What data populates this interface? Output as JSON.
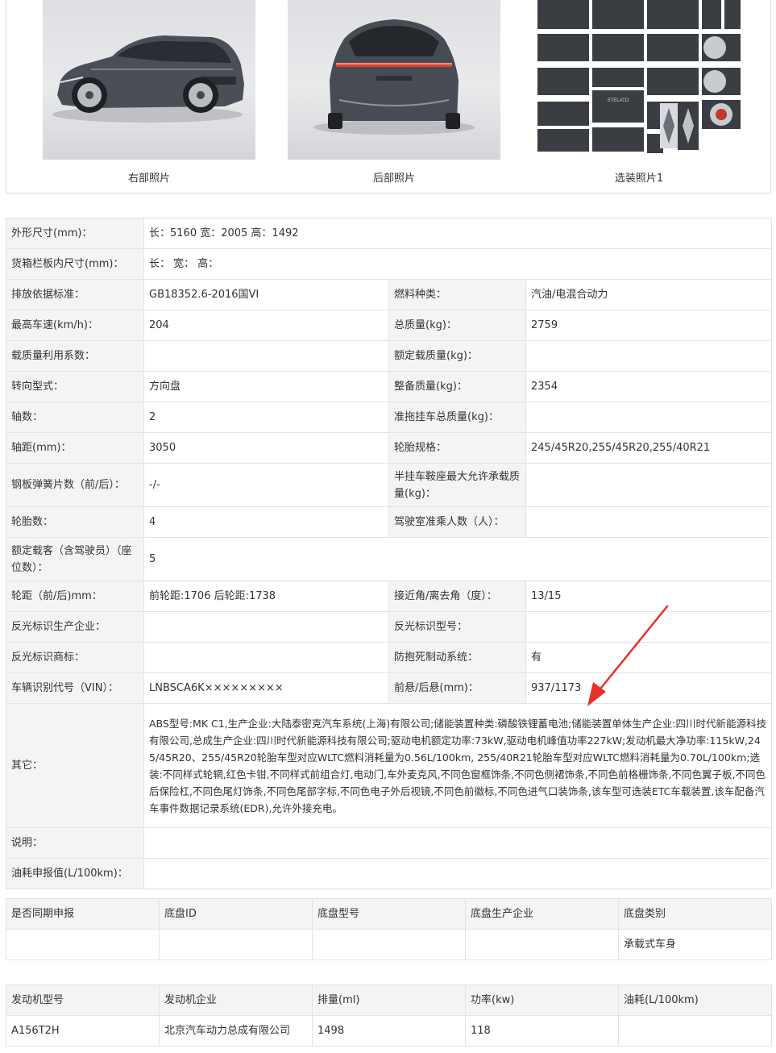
{
  "photos": [
    {
      "caption": "右部照片",
      "icon": "car-right-side-photo"
    },
    {
      "caption": "后部照片",
      "icon": "car-rear-photo",
      "plate_text": "STELATO"
    },
    {
      "caption": "选装照片1",
      "icon": "option-photo-collage"
    }
  ],
  "spec": {
    "dims": {
      "label": "外形尺寸(mm)：",
      "value": "长：5160 宽：2005 高：1492"
    },
    "cargo": {
      "label": "货箱栏板内尺寸(mm)：",
      "value": "长： 宽： 高："
    },
    "rows": [
      {
        "l1": "排放依据标准：",
        "v1": "GB18352.6-2016国VI",
        "l2": "燃料种类：",
        "v2": "汽油/电混合动力"
      },
      {
        "l1": "最高车速(km/h)：",
        "v1": "204",
        "l2": "总质量(kg)：",
        "v2": "2759"
      },
      {
        "l1": "载质量利用系数：",
        "v1": "",
        "l2": "额定载质量(kg)：",
        "v2": ""
      },
      {
        "l1": "转向型式：",
        "v1": "方向盘",
        "l2": "整备质量(kg)：",
        "v2": "2354"
      },
      {
        "l1": "轴数：",
        "v1": "2",
        "l2": "准拖挂车总质量(kg)：",
        "v2": ""
      },
      {
        "l1": "轴距(mm)：",
        "v1": "3050",
        "l2": "轮胎规格：",
        "v2": "245/45R20,255/45R20,255/40R21"
      },
      {
        "l1": "钢板弹簧片数（前/后）：",
        "v1": "-/-",
        "l2": "半挂车鞍座最大允许承载质量(kg)：",
        "v2": ""
      },
      {
        "l1": "轮胎数：",
        "v1": "4",
        "l2": "驾驶室准乘人数（人）：",
        "v2": ""
      }
    ],
    "seats": {
      "label": "额定载客（含驾驶员）（座位数）：",
      "value": "5"
    },
    "rows2": [
      {
        "l1": "轮距（前/后)mm：",
        "v1": "前轮距:1706 后轮距:1738",
        "l2": "接近角/离去角（度）：",
        "v2": "13/15"
      },
      {
        "l1": "反光标识生产企业：",
        "v1": "",
        "l2": "反光标识型号：",
        "v2": ""
      },
      {
        "l1": "反光标识商标：",
        "v1": "",
        "l2": "防抱死制动系统：",
        "v2": "有"
      },
      {
        "l1": "车辆识别代号（VIN）：",
        "v1": "LNBSCA6K×××××××××",
        "l2": "前悬/后悬(mm)：",
        "v2": "937/1173"
      }
    ],
    "other": {
      "label": "其它：",
      "value": "ABS型号:MK C1,生产企业:大陆泰密克汽车系统(上海)有限公司;储能装置种类:磷酸铁锂蓄电池;储能装置单体生产企业:四川时代新能源科技有限公司,总成生产企业:四川时代新能源科技有限公司;驱动电机额定功率:73kW,驱动电机峰值功率227kW;发动机最大净功率:115kW,245/45R20、255/45R20轮胎车型对应WLTC燃料消耗量为0.56L/100km, 255/40R21轮胎车型对应WLTC燃料消耗量为0.70L/100km;选装:不同样式轮辋,红色卡钳,不同样式前组合灯,电动门,车外麦克风,不同色窗框饰条,不同色侧裙饰条,不同色前格栅饰条,不同色翼子板,不同色后保险杠,不同色尾灯饰条,不同色尾部字标,不同色电子外后视镜,不同色前徽标,不同色进气口装饰条,该车型可选装ETC车载装置,该车配备汽车事件数据记录系统(EDR),允许外接充电。"
    },
    "note": {
      "label": "说明：",
      "value": ""
    },
    "fuel": {
      "label": "油耗申报值(L/100km)：",
      "value": ""
    }
  },
  "chassis": {
    "headers": [
      "是否同期申报",
      "底盘ID",
      "底盘型号",
      "底盘生产企业",
      "底盘类别"
    ],
    "values": [
      "",
      "",
      "",
      "",
      "承载式车身"
    ]
  },
  "engine": {
    "headers": [
      "发动机型号",
      "发动机企业",
      "排量(ml)",
      "功率(kw)",
      "油耗(L/100km)"
    ],
    "values": [
      "A156T2H",
      "北京汽车动力总成有限公司",
      "1498",
      "118",
      ""
    ]
  },
  "annotation": {
    "color": "#e8312a",
    "icon": "red-arrow-annotation"
  }
}
